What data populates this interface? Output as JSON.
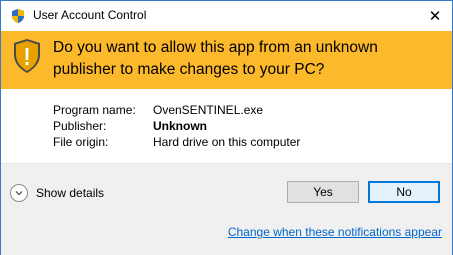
{
  "window": {
    "title": "User Account Control",
    "close_glyph": "✕",
    "icon": "uac-shield-icon"
  },
  "banner": {
    "question": "Do you want to allow this app from an unknown publisher to make changes to your PC?",
    "background_color": "#fcb92c",
    "icon": "uac-shield-icon"
  },
  "details": {
    "program_name_label": "Program name:",
    "program_name_value": "OvenSENTINEL.exe",
    "publisher_label": "Publisher:",
    "publisher_value": "Unknown",
    "file_origin_label": "File origin:",
    "file_origin_value": "Hard drive on this computer"
  },
  "footer": {
    "show_details_label": "Show details",
    "yes_label": "Yes",
    "no_label": "No",
    "notifications_link": "Change when these notifications appear",
    "background_color": "#f0f0f0",
    "link_color": "#0066cc"
  }
}
